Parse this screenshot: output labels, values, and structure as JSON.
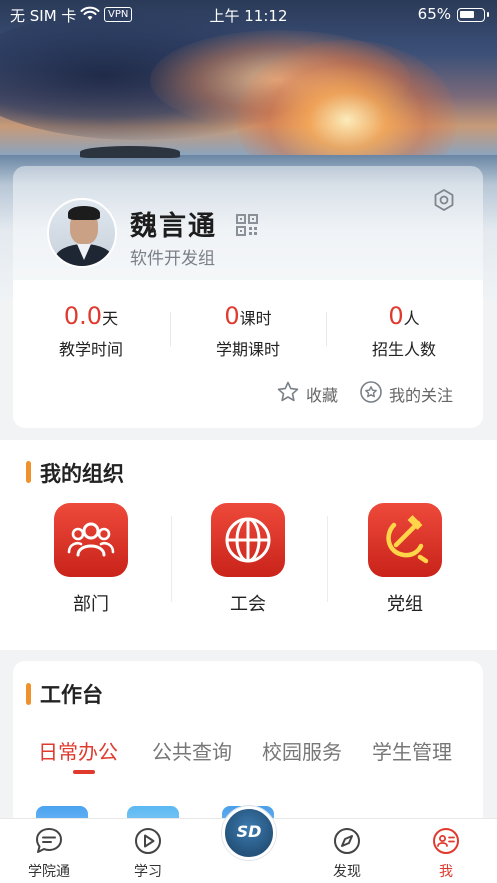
{
  "status_bar": {
    "carrier": "无 SIM 卡",
    "vpn": "VPN",
    "time": "上午 11:12",
    "battery_percent": "65%",
    "battery_level": 0.65
  },
  "profile": {
    "name": "魏言通",
    "department": "软件开发组",
    "stats": [
      {
        "value": "0.0",
        "unit": "天",
        "label": "教学时间"
      },
      {
        "value": "0",
        "unit": "课时",
        "label": "学期课时"
      },
      {
        "value": "0",
        "unit": "人",
        "label": "招生人数"
      }
    ],
    "links": {
      "favorites": "收藏",
      "following": "我的关注"
    }
  },
  "organization": {
    "title": "我的组织",
    "items": [
      {
        "label": "部门",
        "icon": "people-icon"
      },
      {
        "label": "工会",
        "icon": "union-emblem-icon"
      },
      {
        "label": "党组",
        "icon": "hammer-sickle-icon"
      }
    ]
  },
  "workbench": {
    "title": "工作台",
    "tabs": [
      "日常办公",
      "公共查询",
      "校园服务",
      "学生管理"
    ],
    "active_tab": 0
  },
  "tabbar": {
    "items": [
      {
        "label": "学院通",
        "icon": "chat-icon"
      },
      {
        "label": "学习",
        "icon": "play-icon"
      },
      {
        "label": "",
        "icon": "sd-logo-icon"
      },
      {
        "label": "发现",
        "icon": "compass-icon"
      },
      {
        "label": "我",
        "icon": "profile-card-icon"
      }
    ],
    "center_logo_text": "SD",
    "active_index": 4
  },
  "colors": {
    "accent_red": "#e03a2f",
    "section_bar_orange": "#f0922b",
    "org_icon_red": "#d8302a"
  }
}
